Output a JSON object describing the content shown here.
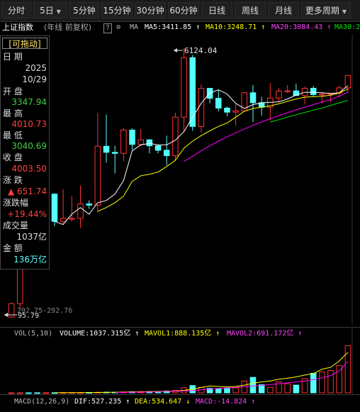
{
  "toolbar": {
    "items": [
      {
        "label": "分时"
      },
      {
        "label": "5日",
        "caret": "▼"
      },
      {
        "label": "5分钟"
      },
      {
        "label": "15分钟"
      },
      {
        "label": "30分钟"
      },
      {
        "label": "60分钟"
      },
      {
        "label": "日线"
      },
      {
        "label": "周线"
      },
      {
        "label": "月线"
      },
      {
        "label": "更多周期",
        "caret": "▼"
      }
    ]
  },
  "info": {
    "index_name": "上证指数",
    "period_note": "(年线 前复权)",
    "help": "?",
    "ma_label": "MA",
    "ma5": "MA5:3411.85 ↑",
    "ma10": "MA10:3248.71 ↑",
    "ma20": "MA20:3084.43 ↑",
    "ma30": "MA30:2"
  },
  "panel": {
    "drag_label": "[可拖动]",
    "date_label": "日  期",
    "year": "2025",
    "date": "10/29",
    "open_label": "开  盘",
    "open": "3347.94",
    "high_label": "最  高",
    "high": "4010.73",
    "low_label": "最  低",
    "low": "3040.69",
    "close_label": "收  盘",
    "close": "4003.50",
    "change_label": "涨  跌",
    "change": "▲ 651.74",
    "pct_label": "涨跌幅",
    "pct": "+19.44%",
    "vol_label": "成交量",
    "vol": "1037亿",
    "amt_label": "金  额",
    "amt": "136万亿"
  },
  "annotations": {
    "high_marker": "6124.04",
    "low_marker": "95.79",
    "low_marker2": "292.75",
    "low_marker3": "292.76"
  },
  "volume_header": {
    "label": "VOL(5,10)",
    "volume": "VOLUME:1037.315亿 ↑",
    "mavol1": "MAVOL1:888.135亿 ↑",
    "mavol2": "MAVOL2:691.172亿 ↑"
  },
  "macd_header": {
    "label": "MACD(12,26,9)",
    "dif": "DIF:527.235 ↑",
    "dea": "DEA:534.647 ↓",
    "macd": "MACD:-14.824 ↑"
  },
  "colors": {
    "up": "#ff3232",
    "down": "#54ffff",
    "ma5": "#ffffff",
    "ma10": "#ffff00",
    "ma20": "#ff00ff",
    "ma30": "#00e600",
    "panel_up": "#ff4040",
    "panel_down": "#40d040",
    "accent": "#ffe66b"
  },
  "chart_data": {
    "type": "candlestick",
    "y_scale": "log",
    "ylim": [
      95,
      6500
    ],
    "candles": [
      {
        "o": 96,
        "h": 120,
        "l": 95,
        "c": 118
      },
      {
        "o": 118,
        "h": 900,
        "l": 110,
        "c": 780
      },
      {
        "o": 780,
        "h": 1560,
        "l": 330,
        "c": 640
      },
      {
        "o": 640,
        "h": 1000,
        "l": 320,
        "c": 560
      },
      {
        "o": 560,
        "h": 780,
        "l": 330,
        "c": 640
      },
      {
        "o": 640,
        "h": 650,
        "l": 390,
        "c": 420
      },
      {
        "o": 420,
        "h": 690,
        "l": 400,
        "c": 440
      },
      {
        "o": 440,
        "h": 620,
        "l": 420,
        "c": 440
      },
      {
        "o": 440,
        "h": 730,
        "l": 380,
        "c": 550
      },
      {
        "o": 550,
        "h": 580,
        "l": 510,
        "c": 540
      },
      {
        "o": 540,
        "h": 2240,
        "l": 480,
        "c": 1340
      },
      {
        "o": 1340,
        "h": 2190,
        "l": 1040,
        "c": 1220
      },
      {
        "o": 1220,
        "h": 1350,
        "l": 880,
        "c": 1200
      },
      {
        "o": 1200,
        "h": 1780,
        "l": 1060,
        "c": 1720
      },
      {
        "o": 1720,
        "h": 1770,
        "l": 1270,
        "c": 1380
      },
      {
        "o": 1380,
        "h": 1750,
        "l": 1340,
        "c": 1480
      },
      {
        "o": 1480,
        "h": 1500,
        "l": 1200,
        "c": 1350
      },
      {
        "o": 1350,
        "h": 1350,
        "l": 1200,
        "c": 1260
      },
      {
        "o": 1260,
        "h": 1580,
        "l": 1000,
        "c": 1160
      },
      {
        "o": 1160,
        "h": 2250,
        "l": 1070,
        "c": 2100
      },
      {
        "o": 2100,
        "h": 6124,
        "l": 1660,
        "c": 5262
      },
      {
        "o": 5262,
        "h": 5500,
        "l": 1700,
        "c": 1820
      },
      {
        "o": 1820,
        "h": 3480,
        "l": 1660,
        "c": 3277
      },
      {
        "o": 3277,
        "h": 3300,
        "l": 2600,
        "c": 2809
      },
      {
        "o": 2809,
        "h": 3200,
        "l": 2300,
        "c": 2416
      },
      {
        "o": 2416,
        "h": 2470,
        "l": 2130,
        "c": 2269
      },
      {
        "o": 2269,
        "h": 2570,
        "l": 1850,
        "c": 2316
      },
      {
        "o": 2316,
        "h": 3100,
        "l": 2300,
        "c": 3060
      },
      {
        "o": 3060,
        "h": 3450,
        "l": 1950,
        "c": 2625
      },
      {
        "o": 2625,
        "h": 2880,
        "l": 2150,
        "c": 2450
      },
      {
        "o": 2450,
        "h": 3560,
        "l": 1990,
        "c": 2821
      },
      {
        "o": 2821,
        "h": 3290,
        "l": 2650,
        "c": 3141
      },
      {
        "o": 3141,
        "h": 3450,
        "l": 3050,
        "c": 3150
      },
      {
        "o": 3150,
        "h": 3520,
        "l": 3000,
        "c": 2931
      },
      {
        "o": 2931,
        "h": 3360,
        "l": 2570,
        "c": 3280
      },
      {
        "o": 3280,
        "h": 3400,
        "l": 2900,
        "c": 2975
      },
      {
        "o": 2975,
        "h": 3100,
        "l": 2600,
        "c": 2991
      },
      {
        "o": 2991,
        "h": 3030,
        "l": 2650,
        "c": 3040
      },
      {
        "o": 3040,
        "h": 3430,
        "l": 2860,
        "c": 3300
      },
      {
        "o": 3300,
        "h": 4010,
        "l": 3040,
        "c": 4003
      }
    ],
    "ma5": [
      null,
      null,
      null,
      null,
      null,
      420,
      400,
      470,
      520,
      470,
      560,
      580,
      640,
      790,
      1250,
      1370,
      1400,
      1370,
      1370,
      1470,
      1680,
      2100,
      2600,
      3050,
      3200,
      3000,
      2600,
      2400,
      2550,
      2620,
      2640,
      2660,
      2780,
      2960,
      3080,
      3080,
      3060,
      3020,
      3060,
      3410
    ],
    "ma10": [
      null,
      null,
      null,
      null,
      null,
      null,
      null,
      null,
      null,
      null,
      490,
      520,
      560,
      620,
      780,
      850,
      870,
      900,
      980,
      1080,
      1300,
      1450,
      1580,
      1700,
      1820,
      1920,
      2100,
      2300,
      2400,
      2450,
      2500,
      2580,
      2680,
      2780,
      2860,
      2880,
      2900,
      2950,
      3050,
      3248
    ],
    "ma20": [
      null,
      null,
      null,
      null,
      null,
      null,
      null,
      null,
      null,
      null,
      null,
      null,
      null,
      null,
      null,
      null,
      null,
      null,
      null,
      null,
      1060,
      1150,
      1250,
      1350,
      1450,
      1550,
      1650,
      1750,
      1850,
      1950,
      2050,
      2150,
      2250,
      2350,
      2450,
      2550,
      2650,
      2750,
      2900,
      3084
    ],
    "ma30": [
      null,
      null,
      null,
      null,
      null,
      null,
      null,
      null,
      null,
      null,
      null,
      null,
      null,
      null,
      null,
      null,
      null,
      null,
      null,
      null,
      null,
      null,
      null,
      null,
      null,
      null,
      null,
      null,
      null,
      null,
      1950,
      2020,
      2100,
      2180,
      2260,
      2340,
      2420,
      2520,
      2620,
      2720
    ],
    "volume": [
      0.5,
      1,
      1.5,
      2,
      3,
      3.5,
      4,
      5,
      6,
      8,
      12,
      15,
      14,
      20,
      25,
      28,
      30,
      32,
      40,
      55,
      110,
      160,
      120,
      100,
      90,
      95,
      110,
      260,
      340,
      180,
      120,
      240,
      200,
      170,
      310,
      430,
      460,
      490,
      600,
      1037
    ],
    "mavol1": [
      null,
      null,
      null,
      null,
      null,
      2,
      3,
      4,
      5,
      6,
      8,
      10,
      12,
      15,
      18,
      22,
      26,
      30,
      33,
      38,
      55,
      80,
      120,
      150,
      140,
      130,
      140,
      170,
      210,
      240,
      260,
      300,
      320,
      350,
      390,
      420,
      520,
      560,
      700,
      888
    ],
    "mavol2": [
      null,
      null,
      null,
      null,
      null,
      null,
      null,
      null,
      null,
      null,
      null,
      null,
      8,
      10,
      12,
      15,
      20,
      24,
      28,
      33,
      40,
      50,
      65,
      85,
      100,
      110,
      120,
      135,
      150,
      165,
      180,
      200,
      220,
      240,
      260,
      290,
      330,
      380,
      480,
      691
    ]
  }
}
